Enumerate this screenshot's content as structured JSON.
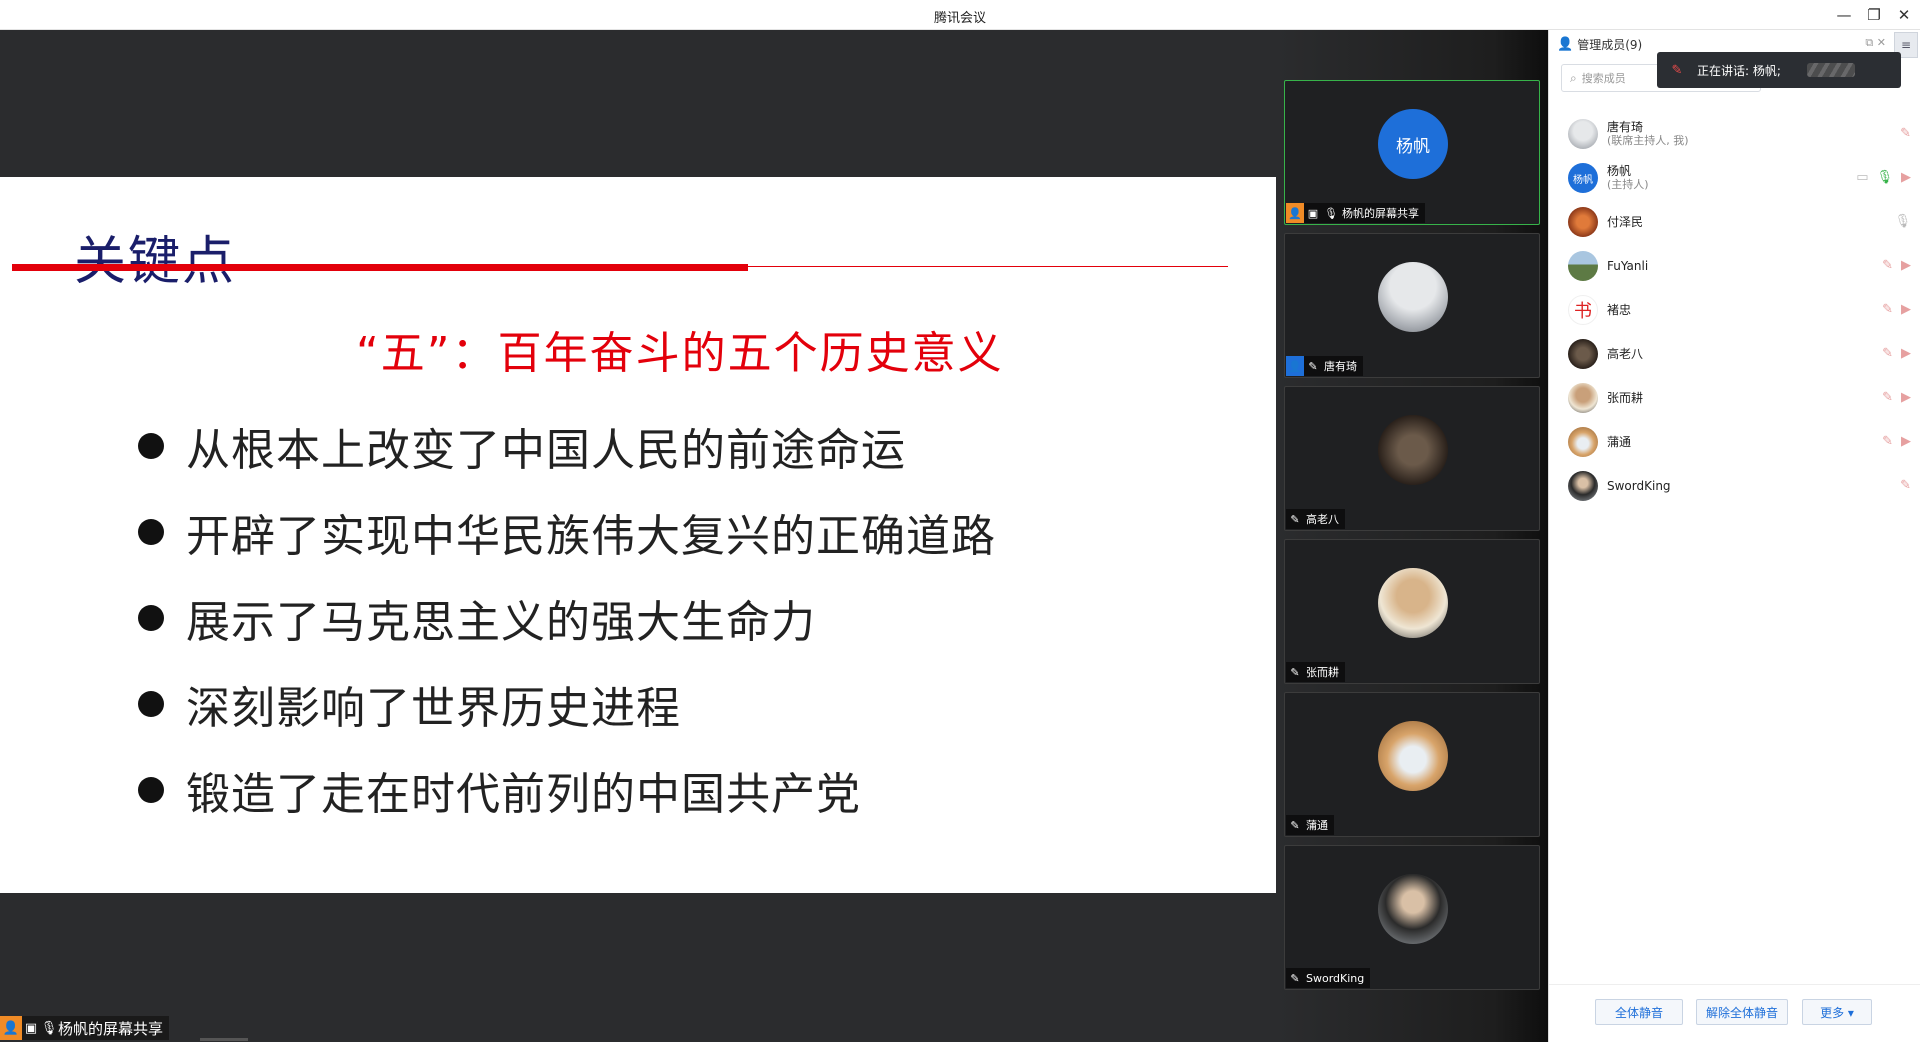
{
  "window": {
    "title": "腾讯会议"
  },
  "slide": {
    "title": "关键点",
    "subtitle": "“五”：百年奋斗的五个历史意义",
    "bullets": [
      "从根本上改变了中国人民的前途命运",
      "开辟了实现中华民族伟大复兴的正确道路",
      "展示了马克思主义的强大生命力",
      "深刻影响了世界历史进程",
      "锻造了走在时代前列的中国共产党"
    ]
  },
  "share_tag": {
    "label": "杨帆的屏幕共享"
  },
  "tiles": [
    {
      "name": "杨帆的屏幕共享",
      "avatar_text": "杨帆",
      "avatar_color": "#1e6fd9"
    },
    {
      "name": "唐有琦",
      "avatar_color": "#c9ccd2"
    },
    {
      "name": "高老八",
      "avatar_color": "#3a2f28"
    },
    {
      "name": "张而耕",
      "avatar_color": "#d9c9a6"
    },
    {
      "name": "蒲通",
      "avatar_color": "#e8c79a"
    },
    {
      "name": "SwordKing",
      "avatar_color": "#8a8f94"
    }
  ],
  "panel": {
    "header": "管理成员(9)",
    "search_placeholder": "搜索成员",
    "toast": "正在讲话: 杨帆;",
    "members": [
      {
        "name": "唐有琦",
        "role": "(联席主持人, 我)",
        "avatar_color": "#c9ccd2"
      },
      {
        "name": "杨帆",
        "role": "(主持人)",
        "avatar_text": "杨帆",
        "avatar_color": "#1e6fd9"
      },
      {
        "name": "付泽民",
        "avatar_color": "#a8431f"
      },
      {
        "name": "FuYanli",
        "avatar_color": "#6b8a55"
      },
      {
        "name": "褚忠",
        "avatar_color": "#ffffff"
      },
      {
        "name": "高老八",
        "avatar_color": "#3a2f28"
      },
      {
        "name": "张而耕",
        "avatar_color": "#d9c9a6"
      },
      {
        "name": "蒲通",
        "avatar_color": "#e8c79a"
      },
      {
        "name": "SwordKing",
        "avatar_color": "#8a8f94"
      }
    ],
    "footer": {
      "mute_all": "全体静音",
      "unmute_all": "解除全体静音",
      "more": "更多 ▾"
    }
  },
  "colors": {
    "accent_red": "#e3000b",
    "title_navy": "#1a1e6a",
    "brand_blue": "#1e6fd9",
    "active_green": "#37b34a"
  }
}
